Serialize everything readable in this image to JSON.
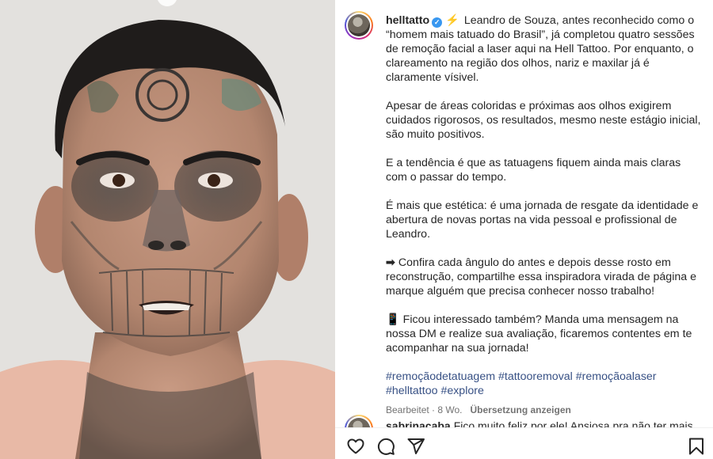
{
  "post": {
    "username": "helltatto",
    "verified_badge": "✓",
    "lead_emoji": "⚡",
    "paragraphs": [
      "Leandro de Souza, antes reconhecido como o “homem mais tatuado do Brasil”, já completou quatro sessões de remoção facial a laser aqui na Hell Tattoo. Por enquanto, o clareamento na região dos olhos, nariz e maxilar já é claramente vísivel.",
      "Apesar de áreas coloridas e próximas aos olhos exigirem cuidados rigorosos, os resultados, mesmo neste estágio inicial, são muito positivos.",
      "E a tendência é que as tatuagens fiquem ainda mais claras com o passar do tempo.",
      "É mais que estética: é uma jornada de resgate da identidade e abertura de novas portas na vida pessoal e profissional de Leandro.",
      "Confira cada ângulo do antes e depois desse rosto em reconstrução, compartilhe essa inspiradora virada de página e marque alguém que precisa conhecer nosso trabalho!",
      "Ficou interessado também? Manda uma mensagem na nossa DM e realize sua avaliação, ficaremos contentes em te acompanhar na sua jornada!"
    ],
    "arrow_emoji": "➡",
    "phone_emoji": "📱",
    "hashtags": [
      "#remoçãodetatuagem",
      "#tattooremoval",
      "#remoçãoalaser",
      "#helltattoo",
      "#explore"
    ],
    "edited_label": "Bearbeitet",
    "time_ago": "8 Wo.",
    "translate_label": "Übersetzung anzeigen"
  },
  "comment": {
    "username": "sabrinacaba",
    "text": "Fico muito feliz por ele! Ansiosa pra não ter mais"
  },
  "actions": {
    "like_icon": "heart-outline",
    "comment_icon": "speech-bubble",
    "share_icon": "paper-plane",
    "save_icon": "bookmark-outline"
  },
  "colors": {
    "hashtag": "#385185",
    "verified": "#3897f0",
    "meta_text": "#737373",
    "text": "#262626"
  }
}
